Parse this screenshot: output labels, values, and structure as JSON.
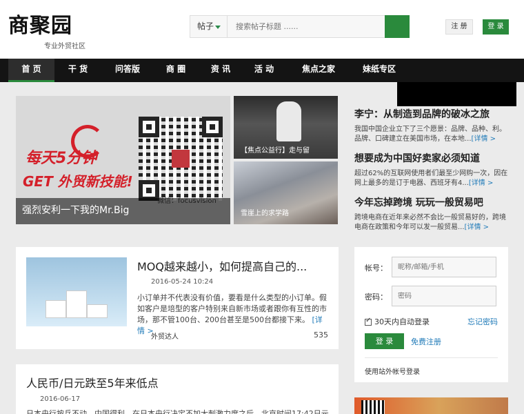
{
  "header": {
    "logo_text": "商聚园",
    "logo_subtitle": "专业外贸社区",
    "search_type": "帖子",
    "search_placeholder": "搜索帖子标题 ......",
    "register_label": "注 册",
    "login_label": "登 录"
  },
  "nav": {
    "items": [
      {
        "label": "首 页",
        "active": true
      },
      {
        "label": "干 货"
      },
      {
        "label": "问答版"
      },
      {
        "label": "商 圈"
      },
      {
        "label": "资 讯"
      },
      {
        "label": "活 动"
      },
      {
        "label": "焦点之家"
      },
      {
        "label": "妹纸专区"
      }
    ]
  },
  "banner": {
    "slogan_1": "每天5分钟",
    "slogan_2": "GET 外贸新技能!",
    "wechat": "微信：focusvision",
    "caption": "强烈安利一下我的Mr.Big"
  },
  "thumbs": [
    {
      "caption": "【焦点公益行】走与留"
    },
    {
      "caption": "雪崖上的求学路"
    }
  ],
  "side_news": [
    {
      "title": "李宁：从制造到品牌的破冰之旅",
      "text": "我国中国企业立下了三个愿景：品牌、品种、利。品牌、口碑建立在美国市场，在本地...",
      "more": "[详情 >"
    },
    {
      "title": "想要成为中国好卖家必须知道",
      "text": "超过62%的互联网使用者们最至少网购一次，因在网上最多的是订于电器、西班牙有4...",
      "more": "[详情 >"
    },
    {
      "title": "今年忘掉跨境 玩玩一般贸易吧",
      "text": "跨境电商在近年来必然不会比一般贸易好的，跨境电商在政策和今年可以发一般贸易...",
      "more": "[详情 >"
    }
  ],
  "articles": [
    {
      "title": "MOQ越来越小，如何提高自己的...",
      "date": "2016-05-24 10:24",
      "body": "小订单并不代表没有价值，要看是什么类型的小订单。假如客户是培型的客户特别来自新市场或者跟你有互性的市场，那不管100台、200台甚至是500台都接下来。",
      "more": "[详情 >",
      "author": "外贸达人",
      "count": "535"
    },
    {
      "title": "人民币/日元跌至5年来低点",
      "date": "2016-06-17",
      "body": "日本央行按兵不动，中国得利。在日本央行决定不加大刺激力度之后，北京时间17:42日元"
    }
  ],
  "login": {
    "account_label": "帐号：",
    "account_placeholder": "昵称/邮箱/手机",
    "password_label": "密码：",
    "password_placeholder": "密码",
    "remember": "30天内自动登录",
    "forgot": "忘记密码",
    "submit": "登 录",
    "free_register": "免费注册",
    "other": "使用站外帐号登录"
  },
  "colors": {
    "brand_green": "#2a8a3c",
    "nav_bg": "#141414",
    "link_blue": "#1f7ab8",
    "slogan_red": "#d4202a"
  }
}
